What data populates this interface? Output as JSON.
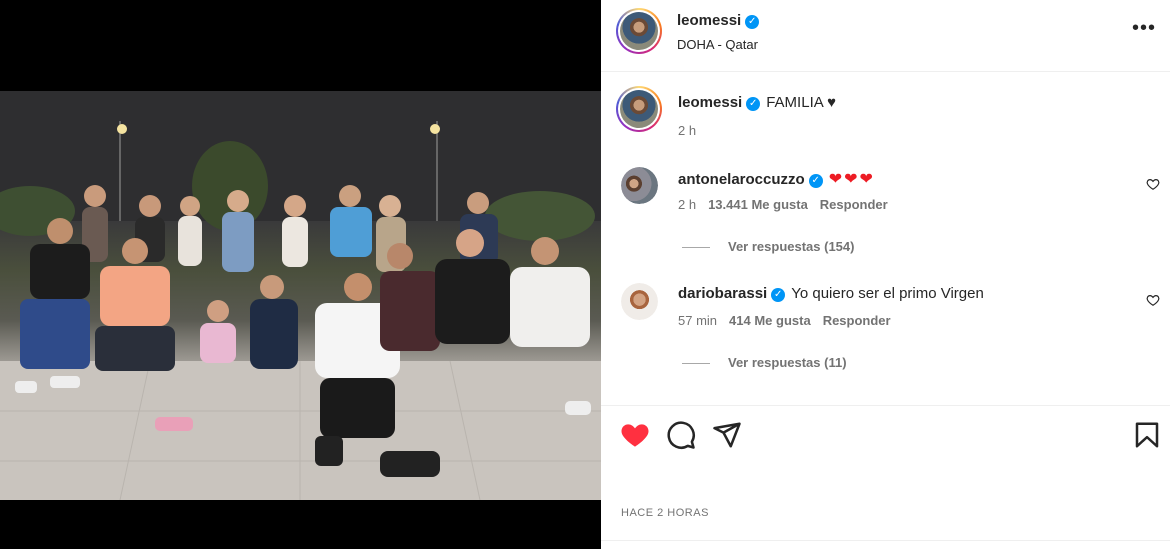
{
  "post": {
    "username": "leomessi",
    "location": "DOHA - Qatar",
    "caption": "FAMILIA ♥",
    "caption_time": "2 h",
    "timestamp": "HACE 2 HORAS",
    "liked": true
  },
  "comments": [
    {
      "username": "antonelaroccuzzo",
      "text": "❤❤❤",
      "time": "2 h",
      "likes": "13.441 Me gusta",
      "reply_label": "Responder",
      "view_replies": "Ver respuestas (154)"
    },
    {
      "username": "dariobarassi",
      "text": "Yo quiero ser el primo Virgen",
      "time": "57 min",
      "likes": "414 Me gusta",
      "reply_label": "Responder",
      "view_replies": "Ver respuestas (11)"
    }
  ],
  "icons": {
    "more": "more-options-icon",
    "like": "heart-filled-icon",
    "comment": "comment-icon",
    "share": "share-icon",
    "save": "bookmark-icon"
  },
  "colors": {
    "like_red": "#ff3040",
    "verified_blue": "#0095f6",
    "muted": "#737373"
  }
}
